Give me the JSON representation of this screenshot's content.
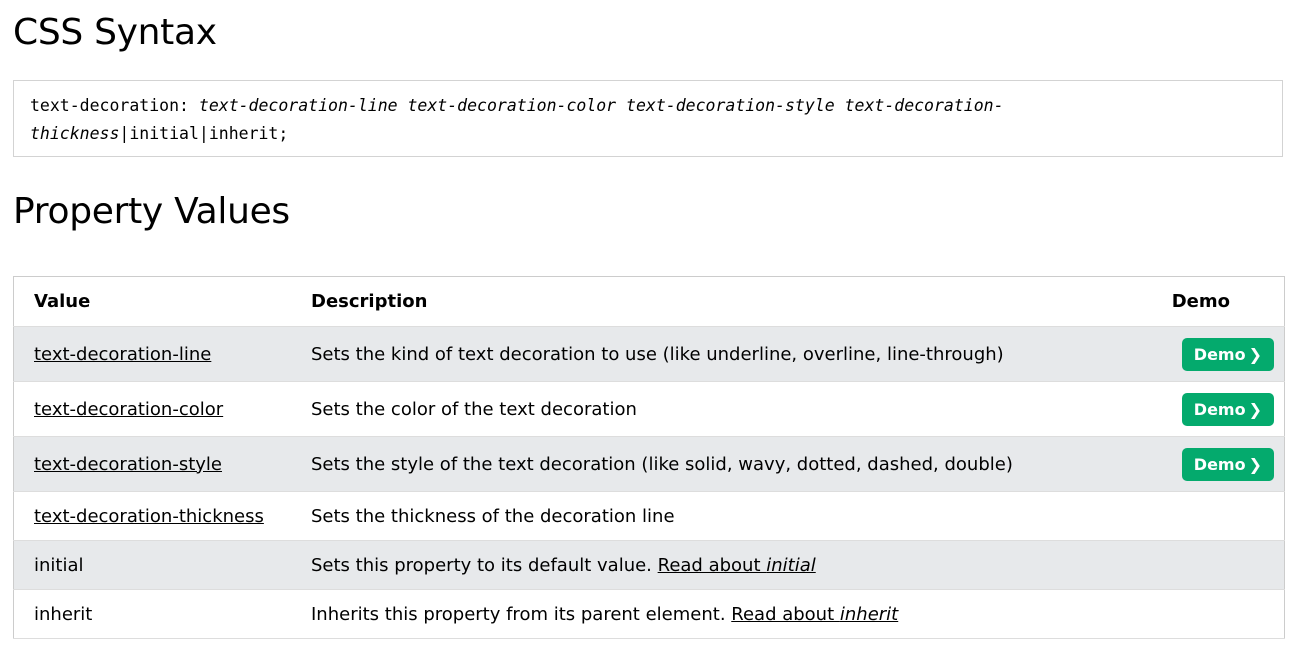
{
  "headings": {
    "syntax": "CSS Syntax",
    "values": "Property Values"
  },
  "syntax": {
    "prefix": "text-decoration: ",
    "args_line1": "text-decoration-line text-decoration-color text-decoration-style text-decoration-",
    "args_line2": "thickness",
    "sep1": "|",
    "initial": "initial",
    "sep2": "|",
    "inherit": "inherit",
    "suffix": ";"
  },
  "table": {
    "headers": {
      "value": "Value",
      "description": "Description",
      "demo": "Demo"
    },
    "rows": [
      {
        "value": "text-decoration-line",
        "description": "Sets the kind of text decoration to use (like underline, overline, line-through)",
        "demo": "Demo",
        "demo_icon": "chevron-right-icon"
      },
      {
        "value": "text-decoration-color",
        "description": "Sets the color of the text decoration",
        "demo": "Demo",
        "demo_icon": "chevron-right-icon"
      },
      {
        "value": "text-decoration-style",
        "description": "Sets the style of the text decoration (like solid, wavy, dotted, dashed, double)",
        "demo": "Demo",
        "demo_icon": "chevron-right-icon"
      },
      {
        "value": "text-decoration-thickness",
        "description": "Sets the thickness of the decoration line"
      },
      {
        "value": "initial",
        "description": "Sets this property to its default value. ",
        "link_text": "Read about ",
        "link_em": "initial"
      },
      {
        "value": "inherit",
        "description": "Inherits this property from its parent element. ",
        "link_text": "Read about ",
        "link_em": "inherit"
      }
    ]
  },
  "colors": {
    "demo_button": "#04aa6d",
    "alt_row": "#e7e9eb",
    "border": "#cccccc"
  }
}
